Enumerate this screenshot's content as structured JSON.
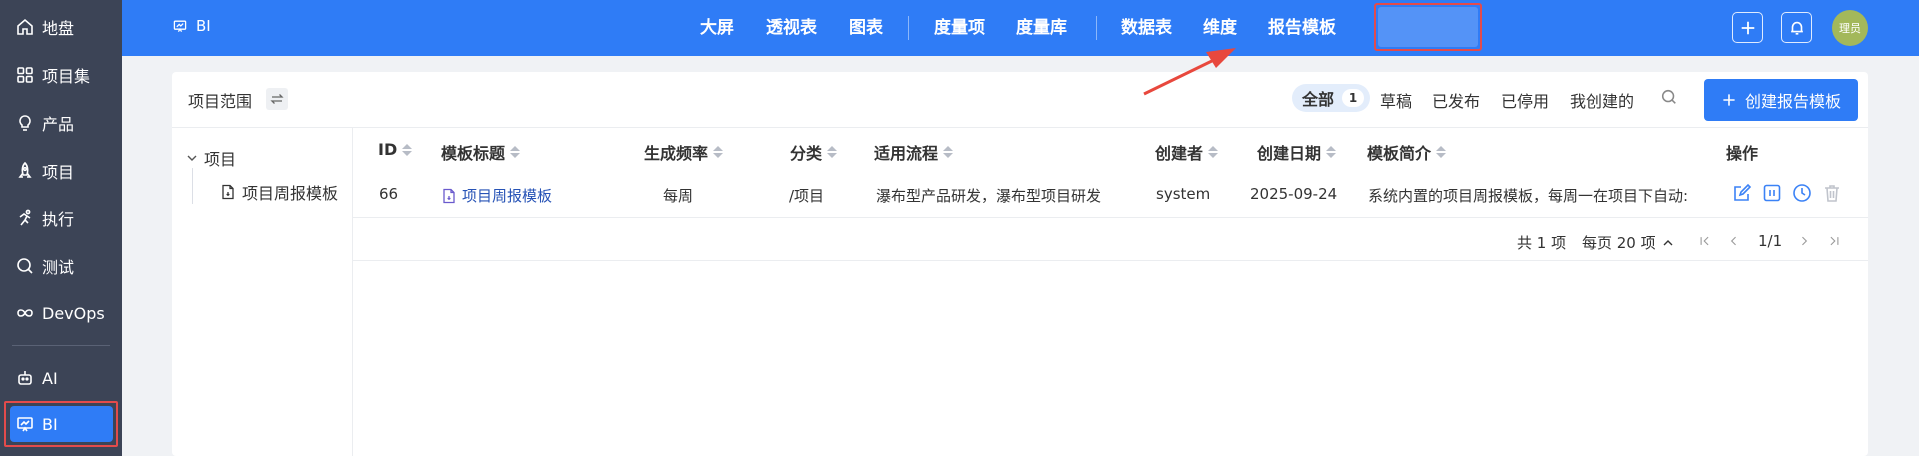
{
  "sidebar": {
    "items": [
      {
        "label": "地盘",
        "icon": "home-icon"
      },
      {
        "label": "项目集",
        "icon": "grid-icon"
      },
      {
        "label": "产品",
        "icon": "bulb-icon"
      },
      {
        "label": "项目",
        "icon": "rocket-icon"
      },
      {
        "label": "执行",
        "icon": "run-icon"
      },
      {
        "label": "测试",
        "icon": "test-icon"
      },
      {
        "label": "DevOps",
        "icon": "infinity-icon"
      },
      {
        "label": "AI",
        "icon": "robot-icon"
      },
      {
        "label": "BI",
        "icon": "chart-board-icon"
      }
    ]
  },
  "topbar": {
    "brand": "BI",
    "nav": [
      "大屏",
      "透视表",
      "图表",
      "度量项",
      "度量库",
      "数据表",
      "维度",
      "报告模板"
    ],
    "active_nav": "报告模板",
    "avatar": "理员"
  },
  "toolbar": {
    "scope_label": "项目范围",
    "filters": {
      "all": "全部",
      "all_count": "1",
      "draft": "草稿",
      "published": "已发布",
      "disabled": "已停用",
      "mine": "我创建的"
    },
    "create_label": "创建报告模板"
  },
  "tree": {
    "root": "项目",
    "child": "项目周报模板"
  },
  "table": {
    "headers": {
      "id": "ID",
      "title": "模板标题",
      "freq": "生成频率",
      "category": "分类",
      "flow": "适用流程",
      "creator": "创建者",
      "date": "创建日期",
      "desc": "模板简介",
      "ops": "操作"
    },
    "rows": [
      {
        "id": "66",
        "title": "项目周报模板",
        "freq": "每周",
        "category": "/项目",
        "flow": "瀑布型产品研发，瀑布型项目研发",
        "creator": "system",
        "date": "2025-09-24",
        "desc": "系统内置的项目周报模板，每周一在项目下自动:"
      }
    ]
  },
  "pager": {
    "total": "共 1 项",
    "per_page": "每页 20 项",
    "page": "1/1"
  },
  "colors": {
    "sidebar": "#3c4456",
    "primary": "#2f7cf6",
    "annotation": "#e34b4b"
  }
}
